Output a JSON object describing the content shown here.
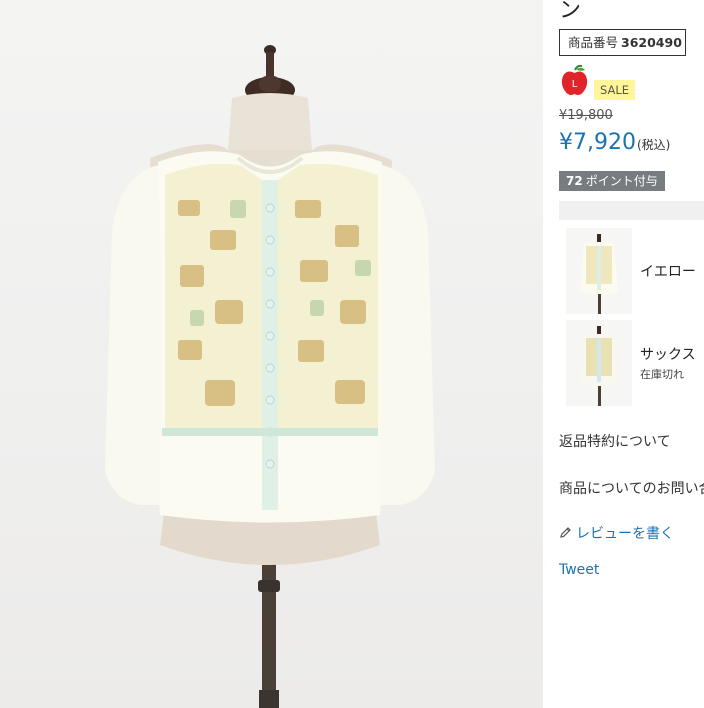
{
  "product": {
    "title_tail": "ン",
    "code_label": "商品番号",
    "code_value": "3620490",
    "size_icon": "apple-icon",
    "size_letter": "L",
    "sale_label": "SALE",
    "old_price": "¥19,800",
    "new_price": "¥7,920",
    "tax_label": "(税込)",
    "points_value": "72",
    "points_label": "ポイント付与"
  },
  "variants": [
    {
      "name": "イエロー",
      "stock": ""
    },
    {
      "name": "サックス",
      "stock": "在庫切れ"
    }
  ],
  "links": {
    "returns": "返品特約について",
    "inquiry": "商品についてのお問い合",
    "review": "レビューを書く",
    "review_icon": "pencil-icon",
    "tweet": "Tweet"
  },
  "colors": {
    "price_blue": "#1b72b2",
    "sale_yellow": "#fff69a",
    "apple_red": "#e0242b",
    "points_gray": "#777c80"
  }
}
